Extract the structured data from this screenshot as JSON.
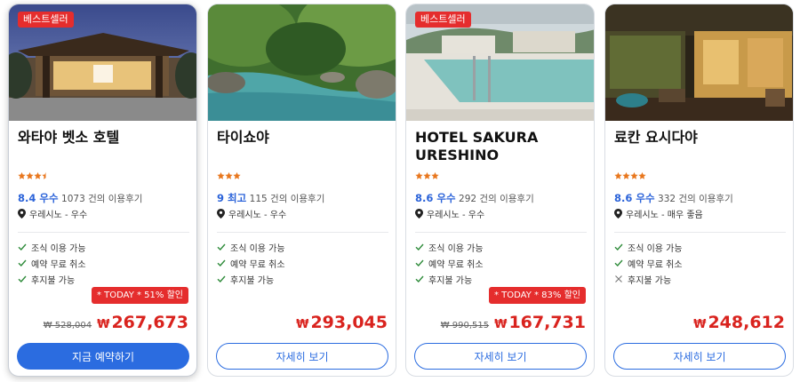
{
  "cards": [
    {
      "badge": "베스트셀러",
      "name": "와타야 벳소 호텔",
      "stars": 3.5,
      "score": "8.4 우수",
      "reviews": "1073 건의 이용후기",
      "location": "우레시노 - 우수",
      "features": [
        {
          "label": "조식 이용 가능",
          "available": true
        },
        {
          "label": "예약 무료 취소",
          "available": true
        },
        {
          "label": "후지불 가능",
          "available": true
        }
      ],
      "deal": "* TODAY * 51% 할인",
      "old_price": "₩ 528,004",
      "currency": "₩",
      "price": "267,673",
      "button": "지금 예약하기"
    },
    {
      "name": "타이쇼야",
      "stars": 3,
      "score": "9 최고",
      "reviews": "115 건의 이용후기",
      "location": "우레시노 - 우수",
      "features": [
        {
          "label": "조식 이용 가능",
          "available": true
        },
        {
          "label": "예약 무료 취소",
          "available": true
        },
        {
          "label": "후지불 가능",
          "available": true
        }
      ],
      "currency": "₩",
      "price": "293,045",
      "button": "자세히 보기"
    },
    {
      "badge": "베스트셀러",
      "name": "HOTEL SAKURA URESHINO",
      "stars": 3,
      "score": "8.6 우수",
      "reviews": "292 건의 이용후기",
      "location": "우레시노 - 우수",
      "features": [
        {
          "label": "조식 이용 가능",
          "available": true
        },
        {
          "label": "예약 무료 취소",
          "available": true
        },
        {
          "label": "후지불 가능",
          "available": true
        }
      ],
      "deal": "* TODAY * 83% 할인",
      "old_price": "₩ 990,515",
      "currency": "₩",
      "price": "167,731",
      "button": "자세히 보기"
    },
    {
      "name": "료칸 요시다야",
      "stars": 4,
      "score": "8.6 우수",
      "reviews": "332 건의 이용후기",
      "location": "우레시노 - 매우 좋음",
      "features": [
        {
          "label": "조식 이용 가능",
          "available": true
        },
        {
          "label": "예약 무료 취소",
          "available": true
        },
        {
          "label": "후지불 가능",
          "available": false
        }
      ],
      "currency": "₩",
      "price": "248,612",
      "button": "자세히 보기"
    }
  ],
  "colors": {
    "accent": "#2b6ce0",
    "badge": "#e52d2d",
    "price": "#d9231e",
    "star": "#e8761c",
    "check": "#2e8b3a",
    "score": "#2b63d9"
  }
}
